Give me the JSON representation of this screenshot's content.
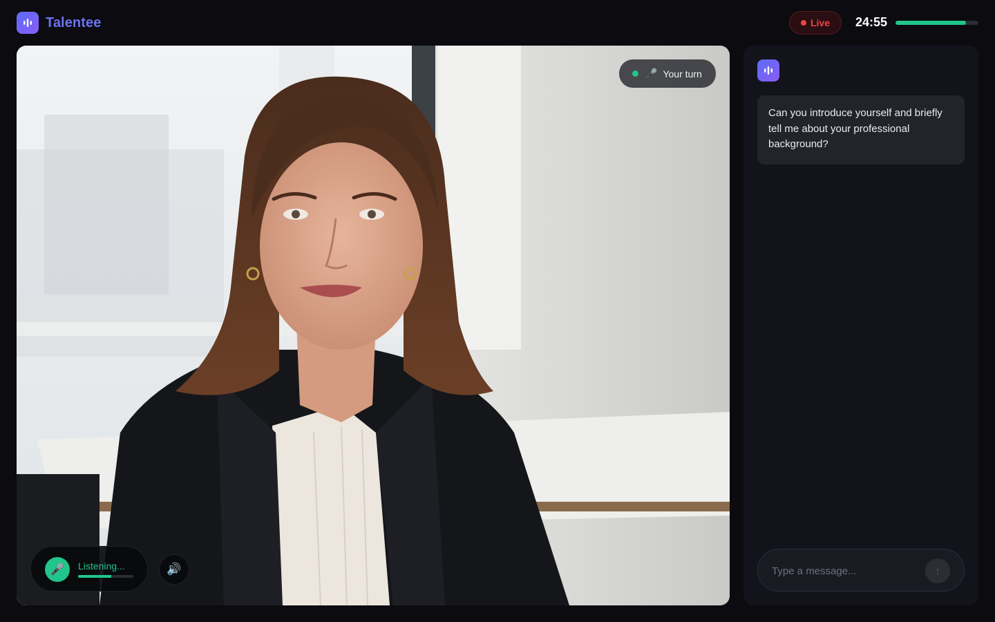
{
  "header": {
    "brand_name": "Talentee",
    "logo_icon": "audio-bars-icon",
    "live_label": "Live",
    "timer": "24:55",
    "time_progress": 0.85
  },
  "video": {
    "turn_label": "Your turn",
    "listening_label": "Listening...",
    "audio_level": 0.6,
    "mic_icon": "microphone-icon",
    "speaker_icon": "speaker-icon"
  },
  "chat": {
    "avatar_icon": "audio-bars-icon",
    "messages": [
      {
        "text": "Can you introduce yourself and briefly tell me about your professional background?"
      }
    ],
    "input_placeholder": "Type a message...",
    "send_icon": "arrow-up-icon"
  },
  "colors": {
    "accent": "#6d72f3",
    "live_red": "#ef4444",
    "success_green": "#22c58b",
    "background": "#0b0b10",
    "panel": "#13131c"
  }
}
